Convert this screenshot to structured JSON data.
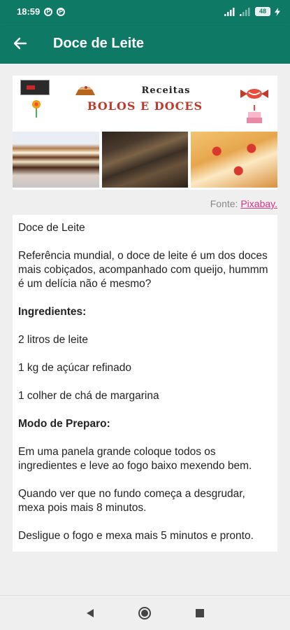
{
  "status_bar": {
    "time": "18:59",
    "notif_p1": "P",
    "notif_p2": "P",
    "battery": "48"
  },
  "app_bar": {
    "title": "Doce de Leite"
  },
  "banner": {
    "title_line1": "Receitas",
    "title_line2": "BOLOS E DOCES"
  },
  "source": {
    "label": "Fonte:",
    "link": "Pixabay."
  },
  "recipe": {
    "name": "Doce de Leite",
    "intro": "Referência mundial, o doce de leite é um dos doces mais cobiçados, acompanhado com queijo, hummm é um delícia não é mesmo?",
    "ingredients_heading": "Ingredientes:",
    "ingredients": [
      "2 litros de leite",
      "1 kg de açúcar refinado",
      "1 colher de chá de margarina"
    ],
    "method_heading": "Modo de Preparo:",
    "steps": [
      "Em uma panela grande coloque todos os ingredientes e leve ao fogo baixo mexendo bem.",
      "Quando ver que no fundo começa a desgrudar, mexa pois mais 8 minutos.",
      "Desligue o fogo e mexa mais 5 minutos e pronto."
    ]
  },
  "colors": {
    "primary": "#0e7a66",
    "link": "#d63384",
    "banner_title": "#c0392b"
  },
  "icons": {
    "back": "arrow-left-icon",
    "nav_back": "triangle-back-icon",
    "nav_home": "circle-home-icon",
    "nav_recent": "square-recent-icon"
  }
}
